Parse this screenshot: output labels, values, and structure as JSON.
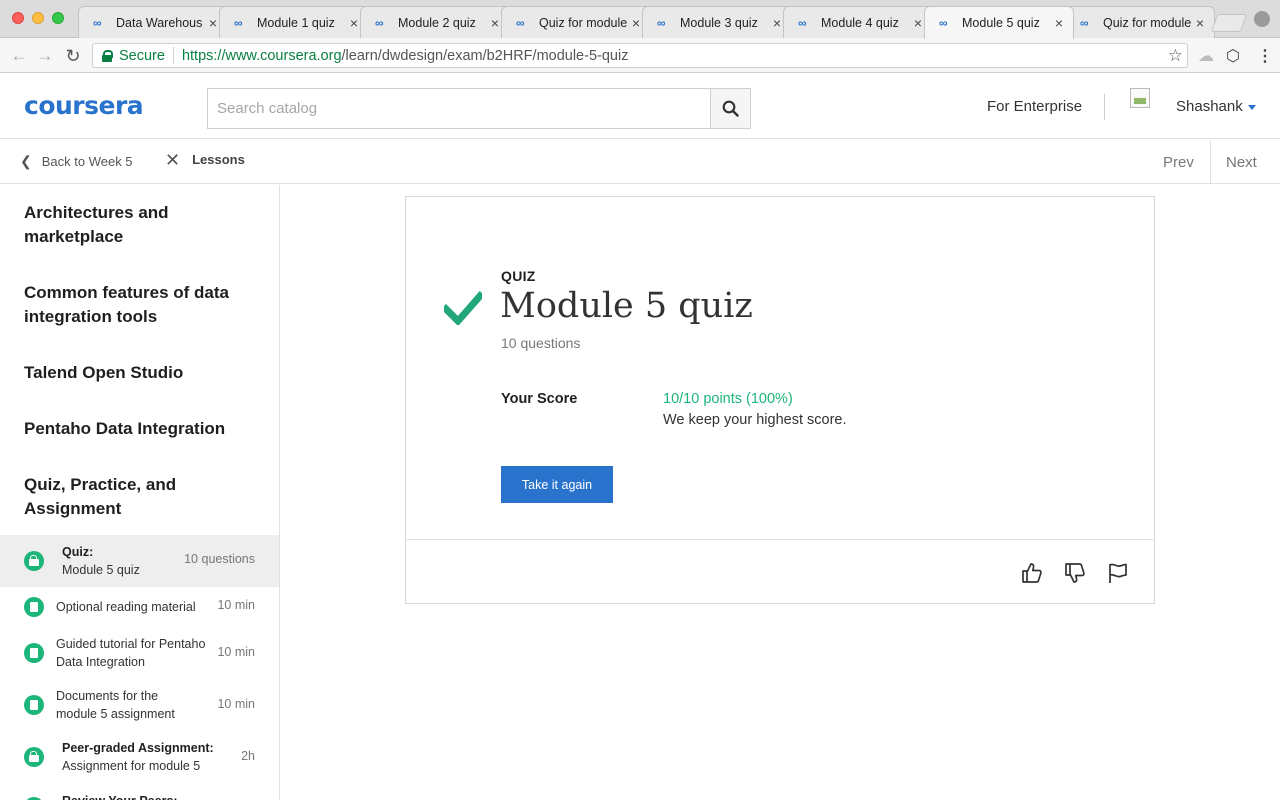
{
  "browser": {
    "tabs": [
      {
        "title": "Data Warehous",
        "active": false
      },
      {
        "title": "Module 1 quiz",
        "active": false
      },
      {
        "title": "Module 2 quiz",
        "active": false
      },
      {
        "title": "Quiz for module",
        "active": false
      },
      {
        "title": "Module 3 quiz",
        "active": false
      },
      {
        "title": "Module 4 quiz",
        "active": false
      },
      {
        "title": "Module 5 quiz",
        "active": true
      },
      {
        "title": "Quiz for module",
        "active": false
      }
    ],
    "secure_label": "Secure",
    "url_host": "https://www.coursera.org",
    "url_path": "/learn/dwdesign/exam/b2HRF/module-5-quiz"
  },
  "header": {
    "logo": "coursera",
    "search_placeholder": "Search catalog",
    "enterprise_link": "For Enterprise",
    "username": "Shashank"
  },
  "subnav": {
    "back_label": "Back to Week 5",
    "lessons_label": "Lessons",
    "prev_label": "Prev",
    "next_label": "Next"
  },
  "sidebar": {
    "sections": [
      {
        "title": "Architectures and marketplace"
      },
      {
        "title": "Common features of data integration tools"
      },
      {
        "title": "Talend Open Studio"
      },
      {
        "title": "Pentaho Data Integration"
      },
      {
        "title": "Quiz, Practice, and Assignment"
      }
    ],
    "items": [
      {
        "kind": "Quiz:",
        "title": "Module 5 quiz",
        "meta": "10 questions",
        "icon": "lock-icon",
        "active": true
      },
      {
        "kind": "",
        "title": "Optional reading material",
        "meta": "10 min",
        "icon": "reading-icon",
        "active": false
      },
      {
        "kind": "",
        "title": "Guided tutorial for Pentaho Data Integration",
        "meta": "10 min",
        "icon": "reading-icon",
        "active": false
      },
      {
        "kind": "",
        "title": "Documents for the module 5 assignment",
        "meta": "10 min",
        "icon": "reading-icon",
        "active": false
      },
      {
        "kind": "Peer-graded Assignment:",
        "title": "Assignment for module 5",
        "meta": "2h",
        "icon": "lock-icon",
        "active": false
      },
      {
        "kind": "Review Your Peers:",
        "title": "",
        "meta": "",
        "icon": "lock-icon",
        "active": false
      }
    ]
  },
  "quiz": {
    "label": "QUIZ",
    "title": "Module 5 quiz",
    "subtitle": "10 questions",
    "score_label": "Your Score",
    "score_value": "10/10 points (100%)",
    "score_note": "We keep your highest score.",
    "retake_label": "Take it again"
  },
  "colors": {
    "brand_blue": "#2a73cc",
    "success_green": "#1cb67a",
    "check_green": "#21a77a"
  }
}
